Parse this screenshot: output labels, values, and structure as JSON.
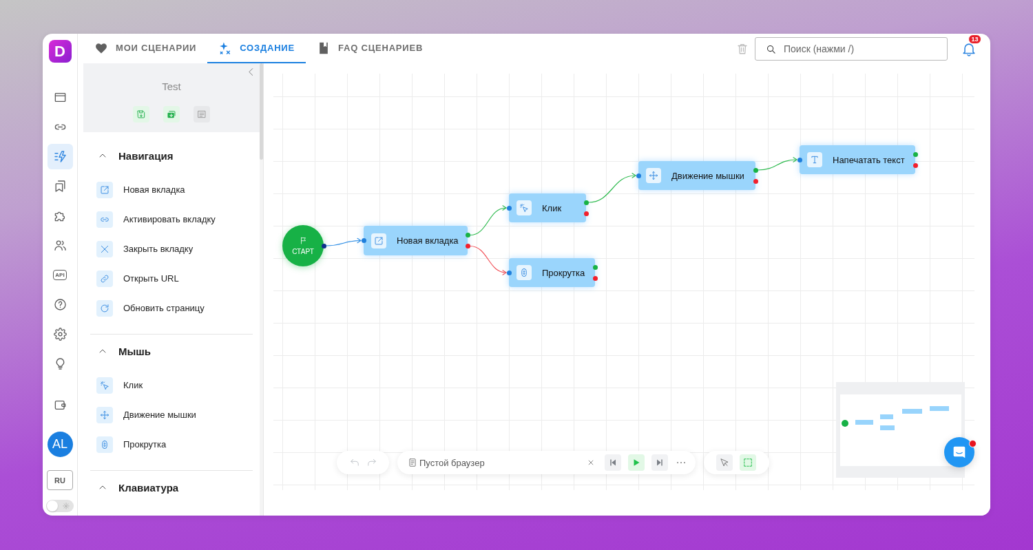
{
  "logo": {
    "text": "D"
  },
  "rail": {
    "items": [
      {
        "kind": "window",
        "selected": false
      },
      {
        "kind": "link",
        "selected": false
      },
      {
        "kind": "flow",
        "selected": true
      },
      {
        "kind": "bookmarks",
        "selected": false
      },
      {
        "kind": "puzzle",
        "selected": false
      },
      {
        "kind": "users",
        "selected": false
      },
      {
        "kind": "api",
        "label": "API",
        "selected": false
      },
      {
        "kind": "help",
        "selected": false
      },
      {
        "kind": "settings",
        "selected": false
      },
      {
        "kind": "bulb",
        "selected": false
      }
    ],
    "bottom_items": [
      {
        "kind": "wallet",
        "selected": false
      }
    ],
    "avatar": {
      "initials": "AL"
    },
    "language": "RU",
    "theme_toggle": {
      "on": false
    }
  },
  "tabs": [
    {
      "kind": "heart",
      "label": "МОИ СЦЕНАРИИ",
      "selected": false
    },
    {
      "kind": "sparkle",
      "label": "СОЗДАНИЕ",
      "selected": true
    },
    {
      "kind": "book",
      "label": "FAQ СЦЕНАРИЕВ",
      "selected": false
    }
  ],
  "search": {
    "placeholder": "Поиск (нажми /)"
  },
  "notifications": {
    "count": "13"
  },
  "panel": {
    "title": "Test",
    "sections": [
      {
        "title": "Навигация",
        "expanded": true,
        "items": [
          {
            "kind": "new-tab",
            "label": "Новая вкладка"
          },
          {
            "kind": "activate-tab",
            "label": "Активировать вкладку"
          },
          {
            "kind": "close-tab",
            "label": "Закрыть вкладку"
          },
          {
            "kind": "open-url",
            "label": "Открыть URL"
          },
          {
            "kind": "refresh",
            "label": "Обновить страницу"
          }
        ]
      },
      {
        "title": "Мышь",
        "expanded": true,
        "items": [
          {
            "kind": "click",
            "label": "Клик"
          },
          {
            "kind": "mouse-move",
            "label": "Движение мышки"
          },
          {
            "kind": "scroll",
            "label": "Прокрутка"
          }
        ]
      },
      {
        "title": "Клавиатура",
        "expanded": true
      }
    ]
  },
  "canvas": {
    "nodes": [
      {
        "kind": "start",
        "label": "СТАРТ"
      },
      {
        "kind": "new-tab",
        "label": "Новая вкладка"
      },
      {
        "kind": "click",
        "label": "Клик"
      },
      {
        "kind": "scroll",
        "label": "Прокрутка"
      },
      {
        "kind": "mouse-move",
        "label": "Движение мышки"
      },
      {
        "kind": "type-text",
        "label": "Напечатать текст"
      }
    ],
    "edges": [
      {
        "kind": "start"
      },
      {
        "kind": "success"
      },
      {
        "kind": "error"
      },
      {
        "kind": "success"
      },
      {
        "kind": "success"
      }
    ]
  },
  "history": [
    {
      "kind": "undo",
      "disabled": true
    },
    {
      "kind": "redo",
      "disabled": true
    }
  ],
  "player": {
    "browser": "Пустой браузер"
  },
  "tools": [
    {
      "kind": "pointer",
      "selected": false
    },
    {
      "kind": "select-area",
      "selected": true
    }
  ],
  "chat": {
    "unread": true
  }
}
